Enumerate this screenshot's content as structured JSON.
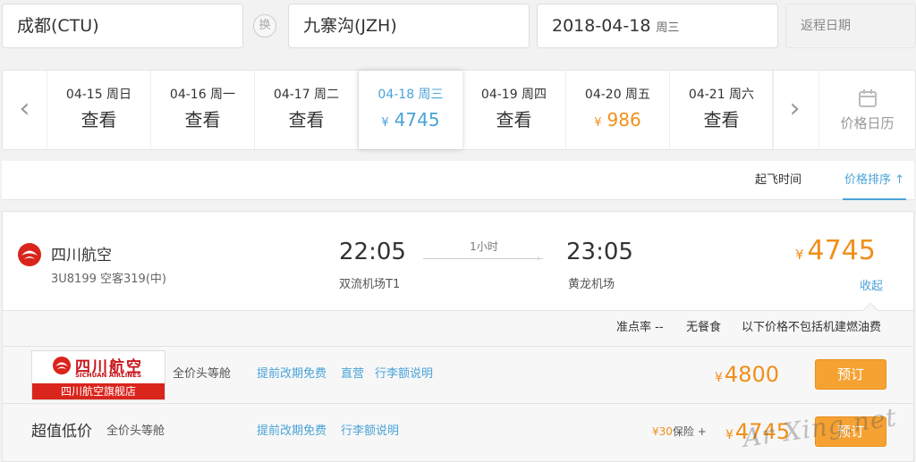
{
  "search": {
    "from": "成都(CTU)",
    "swap_label": "换",
    "to": "九寨沟(JZH)",
    "date": "2018-04-18",
    "weekday": "周三",
    "return_placeholder": "返程日期"
  },
  "date_strip": {
    "days": [
      {
        "date": "04-15 周日",
        "value": "查看"
      },
      {
        "date": "04-16 周一",
        "value": "查看"
      },
      {
        "date": "04-17 周二",
        "value": "查看"
      },
      {
        "date": "04-18 周三",
        "value": "4745",
        "currency": "¥",
        "active": true
      },
      {
        "date": "04-19 周四",
        "value": "查看"
      },
      {
        "date": "04-20 周五",
        "value": "986",
        "currency": "¥"
      },
      {
        "date": "04-21 周六",
        "value": "查看"
      }
    ],
    "calendar_label": "价格日历"
  },
  "sort": {
    "by_time": "起飞时间",
    "by_price": "价格排序"
  },
  "flight": {
    "airline": "四川航空",
    "number_and_aircraft": "3U8199 空客319(中)",
    "dep_time": "22:05",
    "dep_airport": "双流机场T1",
    "duration": "1小时",
    "arr_time": "23:05",
    "arr_airport": "黄龙机场",
    "currency": "¥",
    "price": "4745",
    "collapse": "收起"
  },
  "info": {
    "ontime": "准点率 --",
    "meal": "无餐食",
    "tax_note": "以下价格不包括机建燃油费"
  },
  "fares": {
    "flagship": {
      "logo_brand": "四川航空",
      "logo_brand_en": "SICHUAN AIRLINES",
      "store_name": "四川航空旗舰店",
      "cabin": "全价头等舱",
      "tags": [
        "提前改期免费",
        "直营",
        "行李额说明"
      ],
      "currency": "¥",
      "price": "4800",
      "book": "预订"
    },
    "value": {
      "title": "超值低价",
      "cabin": "全价头等舱",
      "tags": [
        "提前改期免费",
        "行李额说明"
      ],
      "insurance_amount": "¥30",
      "insurance_label": "保险 +",
      "currency": "¥",
      "price": "4745",
      "book": "预订"
    }
  },
  "watermark": "Ar Xing.net",
  "colors": {
    "accent_blue": "#4aa3d8",
    "price_orange": "#f08f1a",
    "book_button": "#f6a233",
    "brand_red": "#c8161d"
  }
}
